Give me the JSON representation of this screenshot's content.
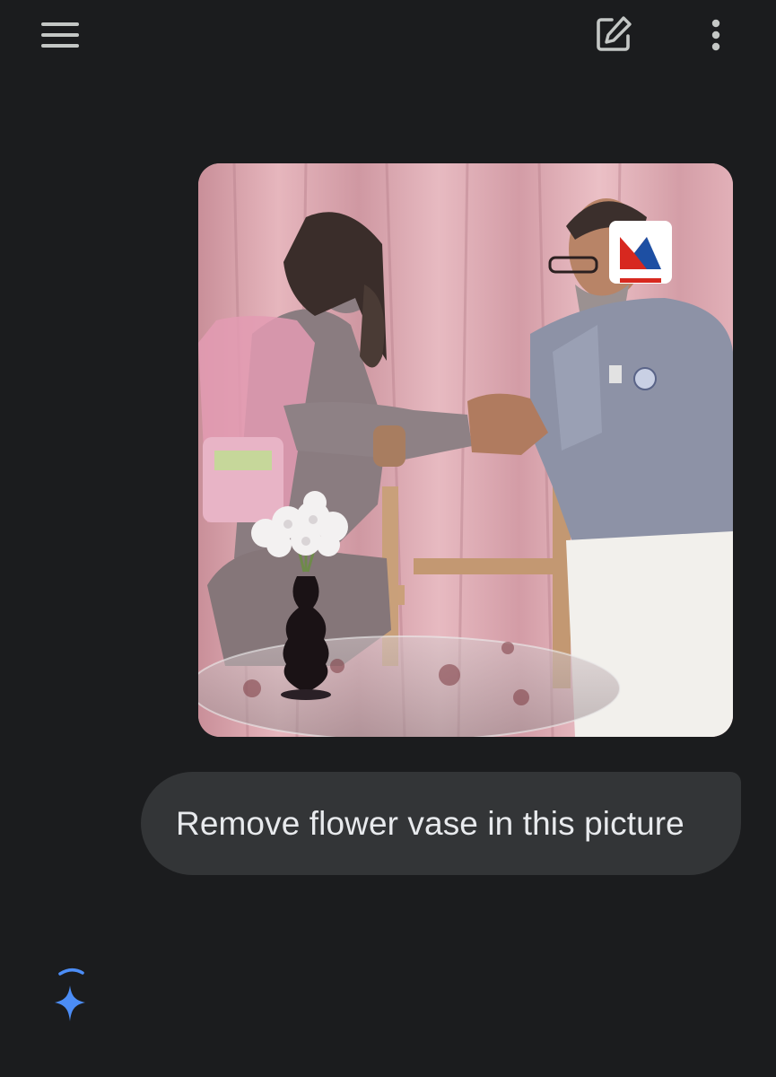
{
  "top_bar": {
    "menu_icon": "hamburger-menu-icon",
    "new_chat_icon": "edit-square-icon",
    "more_icon": "more-vert-icon",
    "icon_color": "#c4c7c5"
  },
  "conversation": {
    "user_image": {
      "description_hidden": true,
      "watermark_logo": "news-channel-logo"
    },
    "user_message": {
      "text": "Remove flower vase in this picture"
    },
    "assistant": {
      "status_icon": "gemini-sparkle-loading-icon",
      "accent_color": "#4c8df6"
    }
  },
  "colors": {
    "background": "#1b1c1e",
    "bubble": "#333537",
    "text": "#e8eaed"
  }
}
